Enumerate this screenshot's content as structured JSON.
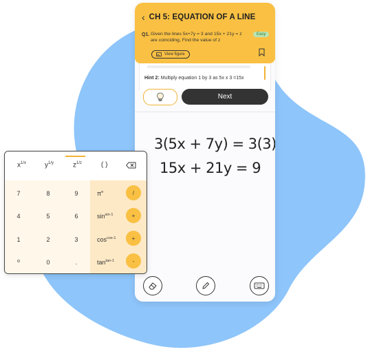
{
  "chapter_title": "CH 5: EQUATION OF A LINE",
  "question": {
    "number": "Q1.",
    "text": "Given the lines 5x+7y = 3 and 15x + 21y = z are coinciding, Find the value of z",
    "difficulty": "Easy",
    "view_figure_label": "View figure"
  },
  "hint": {
    "label": "Hint 2:",
    "text": " Multiply equation 1 by 3 as 5x x 3 =15x"
  },
  "next_label": "Next",
  "handwriting": {
    "line1": "3(5x + 7y) = 3(3)",
    "line2": "15x + 21y = 9"
  },
  "calculator": {
    "top_keys": [
      "x",
      "y",
      "z",
      "( )"
    ],
    "top_sups": [
      "1/x",
      "1/y",
      "1/z"
    ],
    "number_rows": [
      [
        "7",
        "8",
        "9"
      ],
      [
        "4",
        "5",
        "6"
      ],
      [
        "1",
        "2",
        "3"
      ],
      [
        "o",
        "0",
        "."
      ]
    ],
    "sci_keys": [
      "π",
      "sin",
      "cos",
      "tan"
    ],
    "sci_sups": [
      "e",
      "sin-1",
      "cos-1",
      "tan-1"
    ],
    "operators": [
      "/",
      "+",
      "+",
      "-"
    ]
  },
  "colors": {
    "accent": "#f9c043",
    "blob": "#8ec5fa",
    "dark_button": "#333333"
  }
}
